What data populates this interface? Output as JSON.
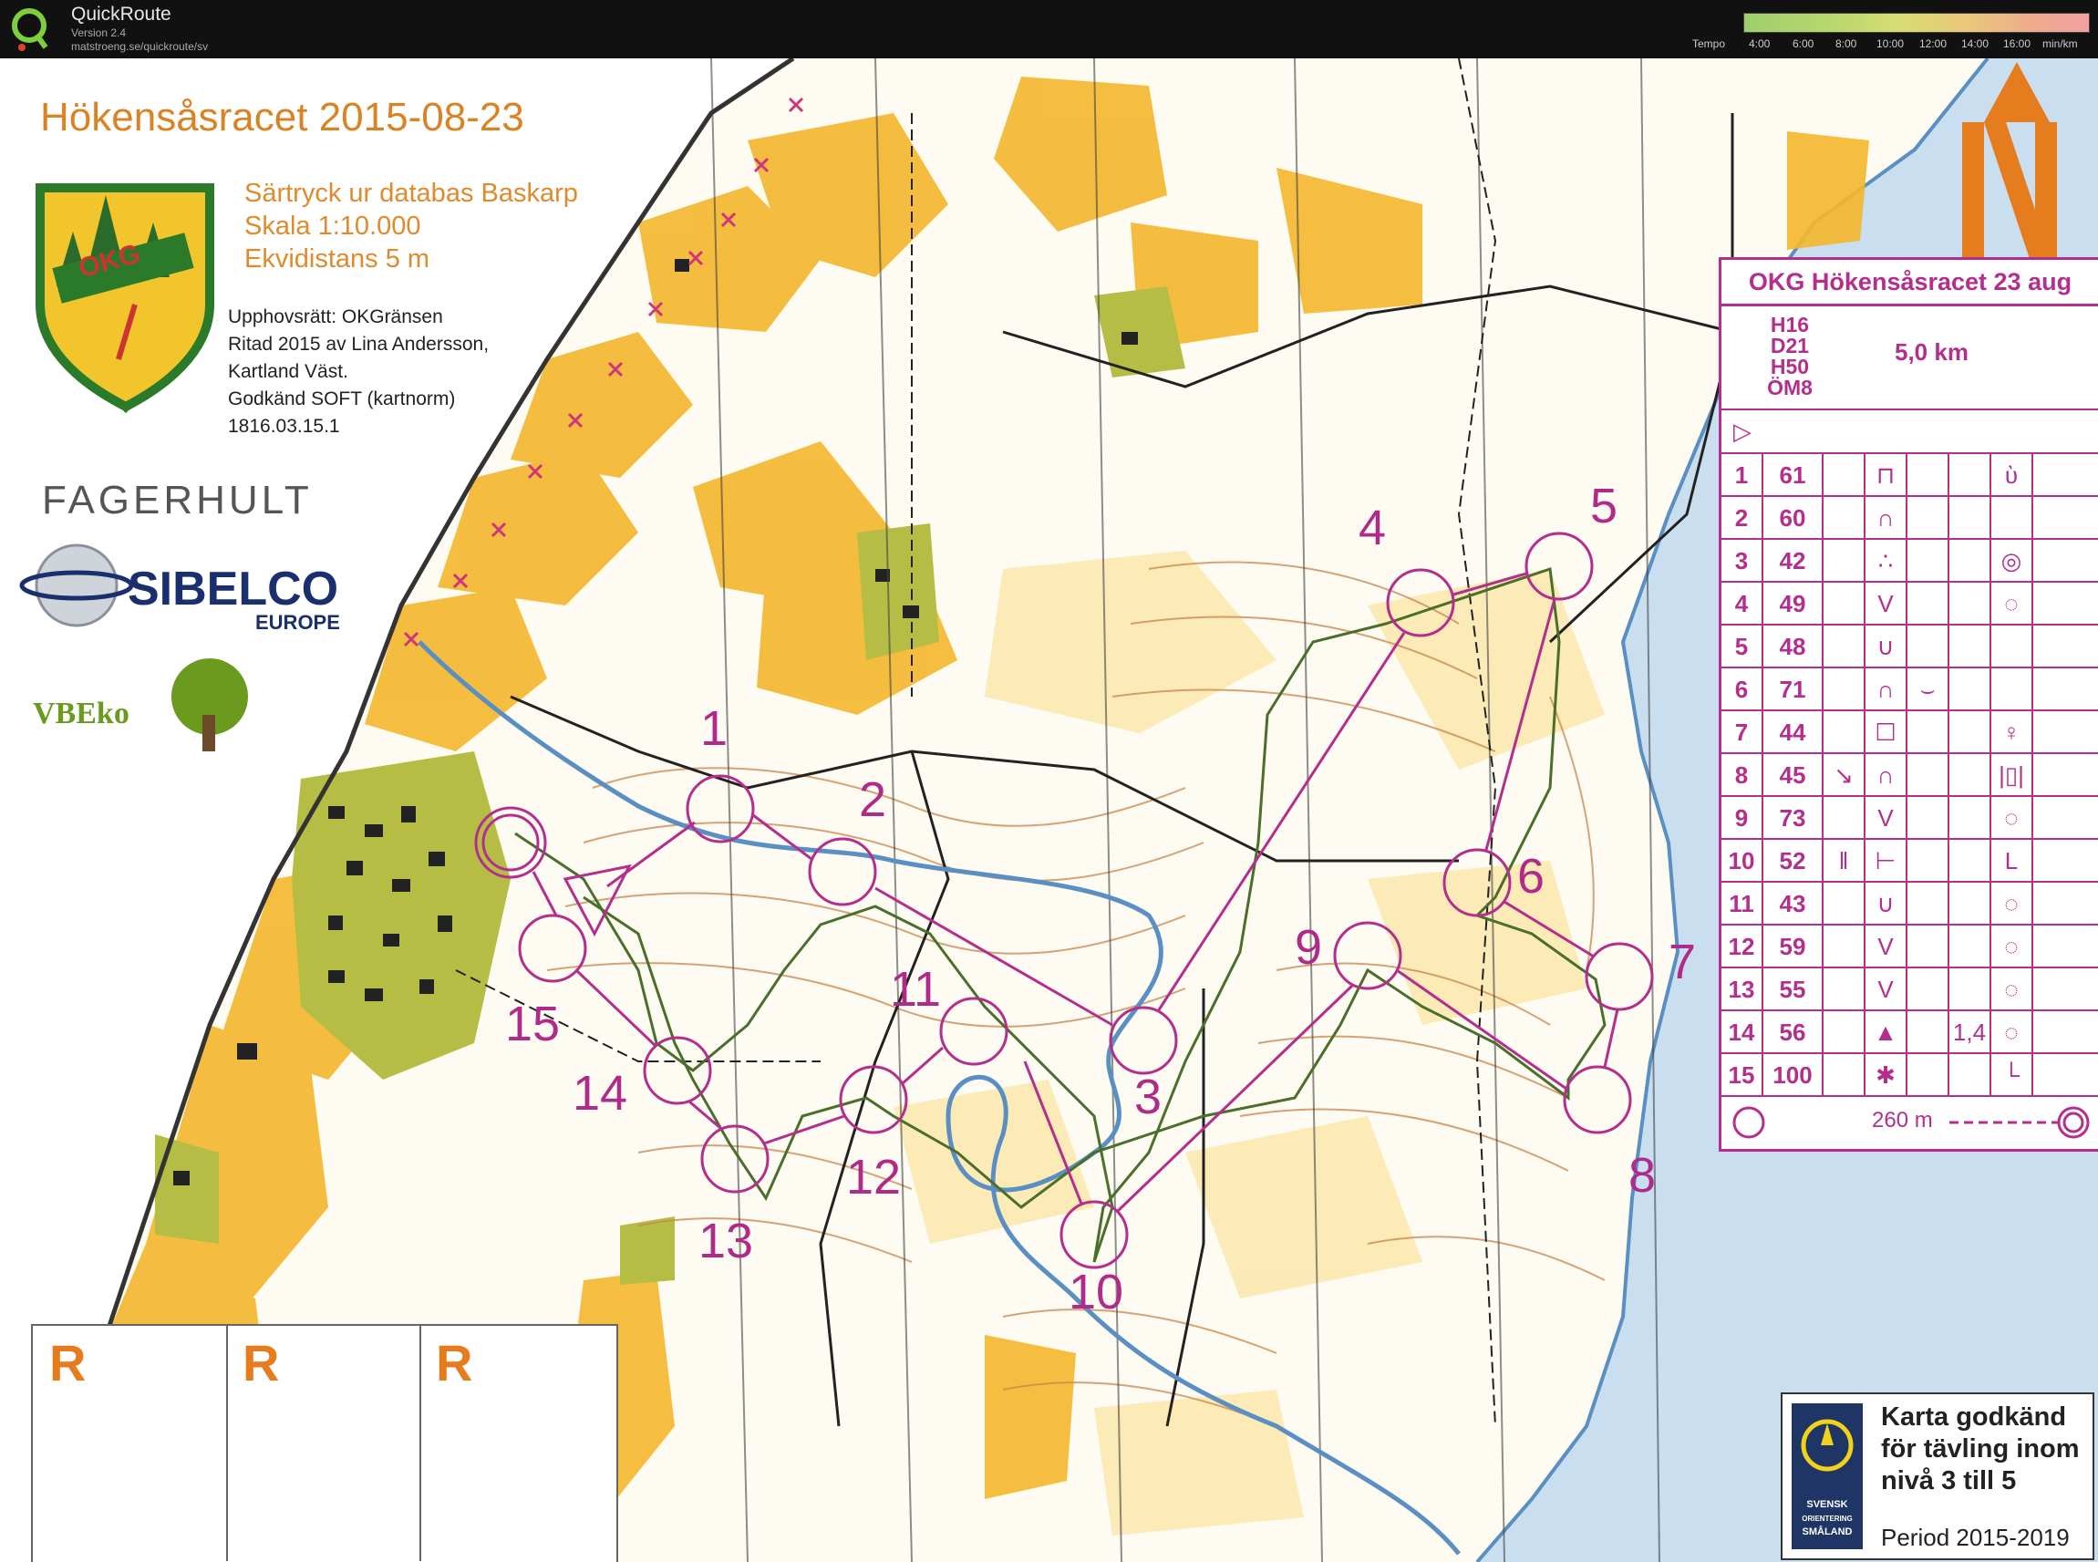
{
  "app": {
    "name": "QuickRoute",
    "version": "Version 2.4",
    "url": "matstroeng.se/quickroute/sv",
    "tempo_label": "Tempo",
    "tempo_ticks": [
      "4:00",
      "6:00",
      "8:00",
      "10:00",
      "12:00",
      "14:00",
      "16:00",
      "min/km"
    ]
  },
  "map": {
    "title": "Hökensåsracet 2015-08-23",
    "info_lines": [
      "Särtryck ur databas Baskarp",
      "Skala 1:10.000",
      "Ekvidistans 5 m"
    ],
    "credits": [
      "Upphovsrätt: OKGränsen",
      "Ritad 2015 av Lina Andersson,",
      "Kartland Väst.",
      "Godkänd SOFT (kartnorm)",
      "1816.03.15.1"
    ],
    "club_logo_text": "OKG",
    "sponsors": {
      "fagerhult": "FAGERHULT",
      "sibelco": "SIBELCO",
      "sibelco_sub": "EUROPE",
      "vbeko": "VBEko"
    },
    "control_numbers": [
      "1",
      "2",
      "3",
      "4",
      "5",
      "6",
      "7",
      "8",
      "9",
      "10",
      "11",
      "12",
      "13",
      "14",
      "15"
    ],
    "colors": {
      "course": "#b42e8e",
      "route": "#4a6f2a",
      "open_land": "#f5b72c",
      "forest": "#fdfbf2",
      "water": "#5a8fc4",
      "title": "#d98324"
    }
  },
  "description": {
    "title": "OKG Hökensåsracet 23 aug",
    "classes": [
      "H16",
      "D21",
      "H50",
      "ÖM8"
    ],
    "length": "5,0 km",
    "rows": [
      {
        "n": "1",
        "code": "61",
        "c": "",
        "d": "⊓",
        "e": "",
        "f": "",
        "g": "ὺ"
      },
      {
        "n": "2",
        "code": "60",
        "c": "",
        "d": "∩",
        "e": "",
        "f": "",
        "g": ""
      },
      {
        "n": "3",
        "code": "42",
        "c": "",
        "d": "∴",
        "e": "",
        "f": "",
        "g": "◎"
      },
      {
        "n": "4",
        "code": "49",
        "c": "",
        "d": "V",
        "e": "",
        "f": "",
        "g": "◌"
      },
      {
        "n": "5",
        "code": "48",
        "c": "",
        "d": "∪",
        "e": "",
        "f": "",
        "g": ""
      },
      {
        "n": "6",
        "code": "71",
        "c": "",
        "d": "∩",
        "e": "⌣",
        "f": "",
        "g": ""
      },
      {
        "n": "7",
        "code": "44",
        "c": "",
        "d": "☐",
        "e": "",
        "f": "",
        "g": "♀"
      },
      {
        "n": "8",
        "code": "45",
        "c": "↘",
        "d": "∩",
        "e": "",
        "f": "",
        "g": "|▯|"
      },
      {
        "n": "9",
        "code": "73",
        "c": "",
        "d": "V",
        "e": "",
        "f": "",
        "g": "◌"
      },
      {
        "n": "10",
        "code": "52",
        "c": "‖",
        "d": "⊢",
        "e": "",
        "f": "",
        "g": "L"
      },
      {
        "n": "11",
        "code": "43",
        "c": "",
        "d": "∪",
        "e": "",
        "f": "",
        "g": "◌"
      },
      {
        "n": "12",
        "code": "59",
        "c": "",
        "d": "V",
        "e": "",
        "f": "",
        "g": "◌"
      },
      {
        "n": "13",
        "code": "55",
        "c": "",
        "d": "V",
        "e": "",
        "f": "",
        "g": "◌"
      },
      {
        "n": "14",
        "code": "56",
        "c": "",
        "d": "▲",
        "e": "",
        "f": "1,4",
        "g": "◌"
      },
      {
        "n": "15",
        "code": "100",
        "c": "",
        "d": "✱",
        "e": "",
        "f": "",
        "g": "└"
      }
    ],
    "finish_distance": "260 m"
  },
  "r_boxes": [
    "R",
    "R",
    "R"
  ],
  "approval": {
    "lines": [
      "Karta godkänd",
      "för tävling inom",
      "nivå 3 till 5"
    ],
    "period": "Period 2015-2019",
    "logo_text": [
      "SVENSK",
      "ORIENTERING",
      "SMÅLAND"
    ]
  }
}
